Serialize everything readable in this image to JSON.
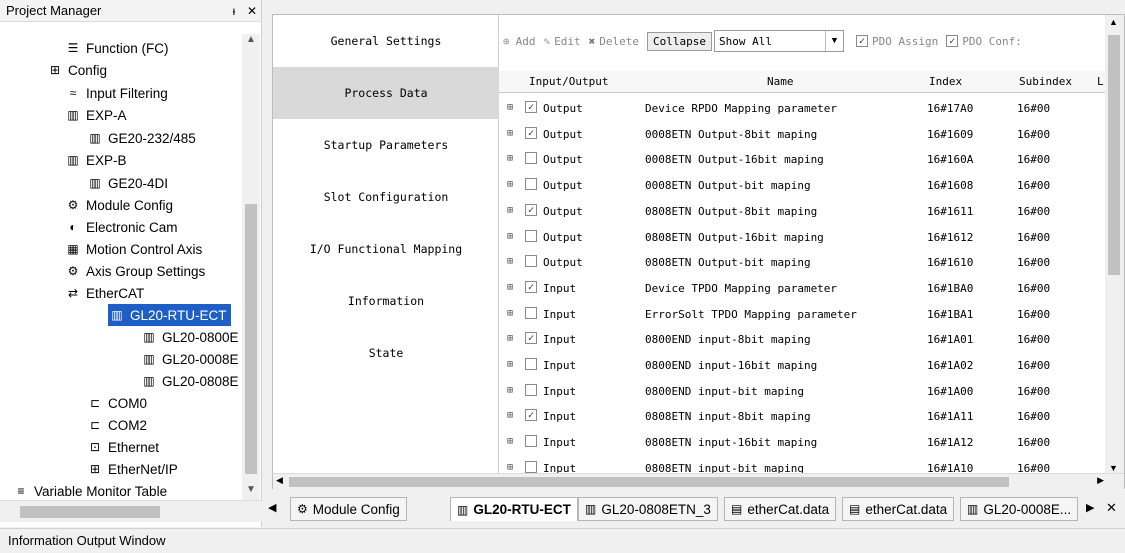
{
  "project_manager": {
    "title": "Project Manager",
    "pin_icon": "pin-icon",
    "close_icon": "close-icon"
  },
  "tree": [
    {
      "label": "Function (FC)",
      "icon": "function-icon"
    },
    {
      "label": "Config",
      "icon": "config-icon"
    },
    {
      "label": "Input Filtering",
      "icon": "filter-icon"
    },
    {
      "label": "EXP-A",
      "icon": "module-icon"
    },
    {
      "label": "GE20-232/485",
      "icon": "module-icon"
    },
    {
      "label": "EXP-B",
      "icon": "module-icon"
    },
    {
      "label": "GE20-4DI",
      "icon": "module-icon"
    },
    {
      "label": "Module Config",
      "icon": "module-config-icon"
    },
    {
      "label": "Electronic Cam",
      "icon": "cam-icon"
    },
    {
      "label": "Motion Control Axis",
      "icon": "axis-icon"
    },
    {
      "label": "Axis Group Settings",
      "icon": "gear-icon"
    },
    {
      "label": "EtherCAT",
      "icon": "ethercat-icon"
    },
    {
      "label": "GL20-RTU-ECT",
      "icon": "device-icon"
    },
    {
      "label": "GL20-0800E",
      "icon": "device-icon"
    },
    {
      "label": "GL20-0008E",
      "icon": "device-icon"
    },
    {
      "label": "GL20-0808E",
      "icon": "device-icon"
    },
    {
      "label": "COM0",
      "icon": "com-icon"
    },
    {
      "label": "COM2",
      "icon": "com-icon"
    },
    {
      "label": "Ethernet",
      "icon": "ethernet-icon"
    },
    {
      "label": "EtherNet/IP",
      "icon": "ethernet-ip-icon"
    },
    {
      "label": "Variable Monitor Table",
      "icon": "monitor-icon"
    }
  ],
  "nav": [
    "General Settings",
    "Process Data",
    "Startup Parameters",
    "Slot Configuration",
    "I/O Functional Mapping",
    "Information",
    "State"
  ],
  "toolbar": {
    "add": "Add",
    "edit": "Edit",
    "delete": "Delete",
    "collapse": "Collapse",
    "show_all": "Show All",
    "pdo_assign": "PDO Assign",
    "pdo_conf": "PDO Conf:"
  },
  "table": {
    "headers": [
      "Input/Output",
      "Name",
      "Index",
      "Subindex",
      "L"
    ],
    "rows": [
      {
        "checked": true,
        "io": "Output",
        "name": "Device RPDO Mapping parameter",
        "index": "16#17A0",
        "sub": "16#00"
      },
      {
        "checked": true,
        "io": "Output",
        "name": "0008ETN Output-8bit maping",
        "index": "16#1609",
        "sub": "16#00"
      },
      {
        "checked": false,
        "io": "Output",
        "name": "0008ETN Output-16bit maping",
        "index": "16#160A",
        "sub": "16#00"
      },
      {
        "checked": false,
        "io": "Output",
        "name": "0008ETN Output-bit maping",
        "index": "16#1608",
        "sub": "16#00"
      },
      {
        "checked": true,
        "io": "Output",
        "name": "0808ETN Output-8bit maping",
        "index": "16#1611",
        "sub": "16#00"
      },
      {
        "checked": false,
        "io": "Output",
        "name": "0808ETN Output-16bit maping",
        "index": "16#1612",
        "sub": "16#00"
      },
      {
        "checked": false,
        "io": "Output",
        "name": "0808ETN Output-bit maping",
        "index": "16#1610",
        "sub": "16#00"
      },
      {
        "checked": true,
        "io": "Input",
        "name": "Device TPDO Mapping parameter",
        "index": "16#1BA0",
        "sub": "16#00"
      },
      {
        "checked": false,
        "io": "Input",
        "name": "ErrorSolt TPDO Mapping parameter",
        "index": "16#1BA1",
        "sub": "16#00"
      },
      {
        "checked": true,
        "io": "Input",
        "name": "0800END input-8bit maping",
        "index": "16#1A01",
        "sub": "16#00"
      },
      {
        "checked": false,
        "io": "Input",
        "name": "0800END input-16bit maping",
        "index": "16#1A02",
        "sub": "16#00"
      },
      {
        "checked": false,
        "io": "Input",
        "name": "0800END input-bit maping",
        "index": "16#1A00",
        "sub": "16#00"
      },
      {
        "checked": true,
        "io": "Input",
        "name": "0808ETN input-8bit maping",
        "index": "16#1A11",
        "sub": "16#00"
      },
      {
        "checked": false,
        "io": "Input",
        "name": "0808ETN input-16bit maping",
        "index": "16#1A12",
        "sub": "16#00"
      },
      {
        "checked": false,
        "io": "Input",
        "name": "0808ETN input-bit maping",
        "index": "16#1A10",
        "sub": "16#00"
      }
    ]
  },
  "tabs": [
    "Module Config",
    "GL20-RTU-ECT",
    "GL20-0808ETN_3",
    "etherCat.data",
    "etherCat.data",
    "GL20-0008E..."
  ],
  "footer": "Information Output Window"
}
